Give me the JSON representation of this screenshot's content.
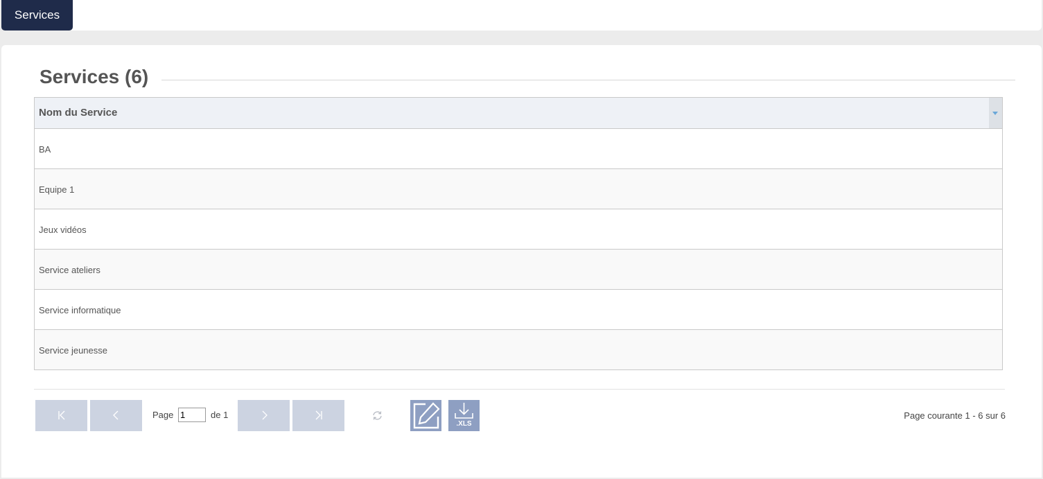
{
  "tabs": {
    "active_label": "Services"
  },
  "main": {
    "title": "Services (6)",
    "column_header": "Nom du Service",
    "rows": [
      "BA",
      "Equipe 1",
      "Jeux vidéos",
      "Service ateliers",
      "Service informatique",
      "Service jeunesse"
    ]
  },
  "pager": {
    "page_label": "Page",
    "page_value": "1",
    "of_label": "de 1",
    "info": "Page courante 1 - 6 sur 6",
    "xls_label": ".XLS"
  },
  "icons": {
    "first": "first-page-icon",
    "prev": "prev-page-icon",
    "next": "next-page-icon",
    "last": "last-page-icon",
    "refresh": "refresh-icon",
    "edit": "edit-icon",
    "export": "download-icon"
  },
  "colors": {
    "tab_active": "#1f2b4a",
    "header_bg": "#eef1f6",
    "pager_button": "#ccd3e1",
    "action_button": "#8e9fc2",
    "sort_caret": "#6aa7d8"
  }
}
